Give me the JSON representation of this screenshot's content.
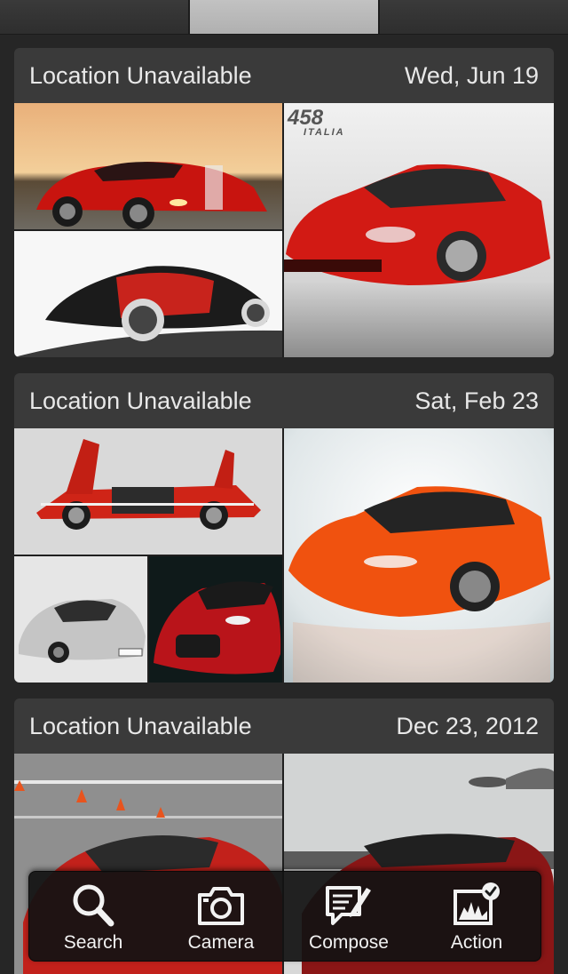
{
  "top_tabs": [
    "",
    "",
    ""
  ],
  "cards": [
    {
      "location": "Location Unavailable",
      "date": "Wed, Jun 19"
    },
    {
      "location": "Location Unavailable",
      "date": "Sat, Feb 23"
    },
    {
      "location": "Location Unavailable",
      "date": "Dec 23, 2012"
    }
  ],
  "photo_text": {
    "ferrari_model": "458",
    "ferrari_sub": "ITALIA"
  },
  "toolbar": {
    "search": {
      "label": "Search",
      "icon": "search-icon"
    },
    "camera": {
      "label": "Camera",
      "icon": "camera-icon"
    },
    "compose": {
      "label": "Compose",
      "icon": "compose-icon"
    },
    "action": {
      "label": "Action",
      "icon": "action-icon"
    }
  },
  "colors": {
    "background": "#262626",
    "card": "#3a3a3a",
    "card_text": "#e8e8e8",
    "active_tab": "#b8b8b8",
    "car_red": "#d21a14"
  }
}
